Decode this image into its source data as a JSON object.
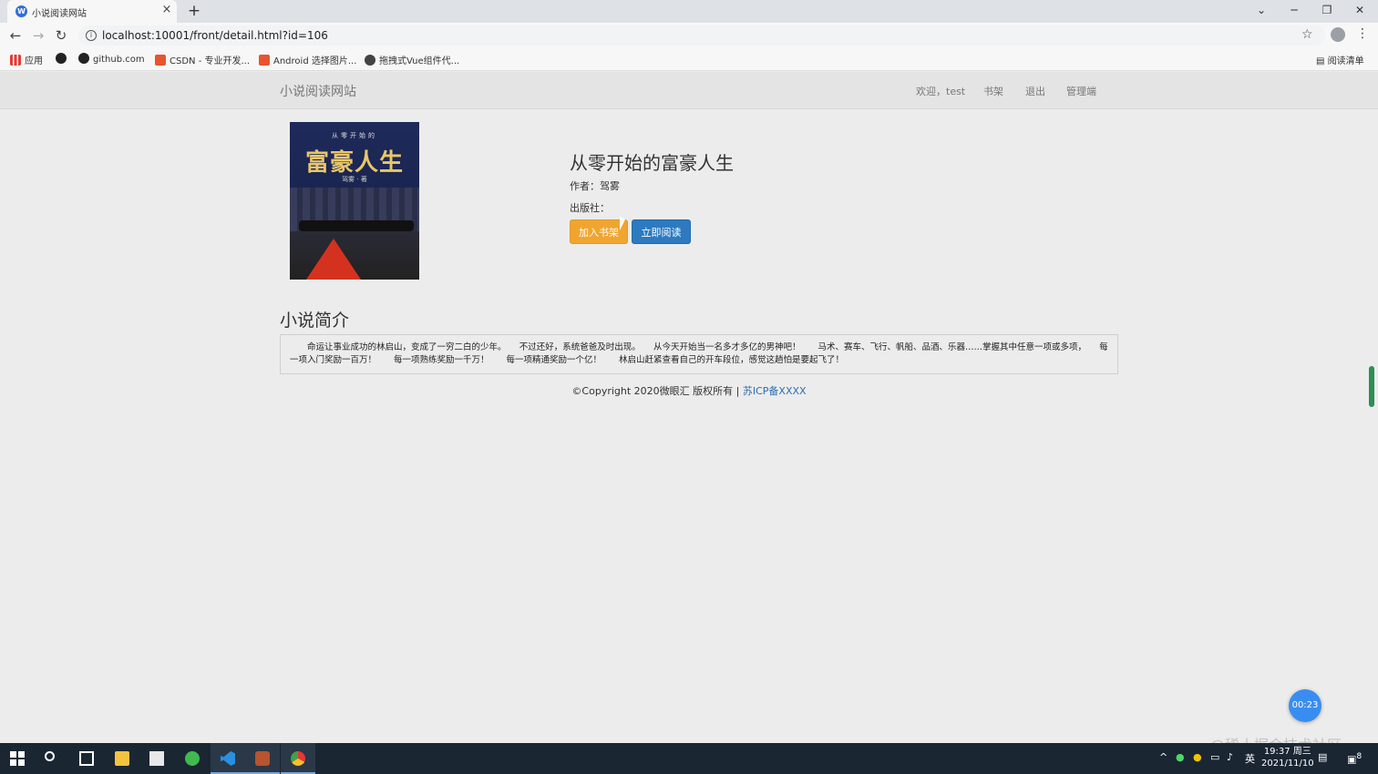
{
  "browser": {
    "tab_title": "小说阅读网站",
    "tab_close": "×",
    "new_tab": "+",
    "url": "localhost:10001/front/detail.html?id=106",
    "bookmarks": [
      {
        "label": "应用",
        "icon": "apps-icon"
      },
      {
        "label": "",
        "icon": "github-icon"
      },
      {
        "label": "github.com",
        "icon": "github-icon"
      },
      {
        "label": "CSDN - 专业开发...",
        "icon": "csdn-icon"
      },
      {
        "label": "Android 选择图片...",
        "icon": "csdn-icon"
      },
      {
        "label": "拖拽式Vue组件代...",
        "icon": "vue-icon"
      }
    ],
    "reading_list": "阅读清单"
  },
  "navbar": {
    "brand": "小说阅读网站",
    "welcome": "欢迎，test",
    "bookshelf": "书架",
    "logout": "退出",
    "admin": "管理端"
  },
  "book": {
    "cover": {
      "subtitle": "从零开始的",
      "title": "富豪人生",
      "author": "驾雾 · 著"
    },
    "title": "从零开始的富豪人生",
    "author_line": "作者：驾雾",
    "publisher_line": "出版社：",
    "add_shelf_label": "加入书架",
    "read_now_label": "立即阅读"
  },
  "intro": {
    "heading": "小说简介",
    "text": "　　命运让事业成功的林启山，变成了一穷二白的少年。　　不过还好，系统爸爸及时出现。　　从今天开始当一名多才多亿的男神吧！　　马术、赛车、飞行、帆船、品酒、乐器……掌握其中任意一项或多项，　　每一项入门奖励一百万！　　每一项熟练奖励一千万！　　每一项精通奖励一个亿！　　林启山赶紧查看自己的开车段位，感觉这趟怕是要起飞了！"
  },
  "footer": {
    "copyright": "©Copyright 2020微眼汇 版权所有 | ",
    "icp": "苏ICP备XXXX"
  },
  "overlay": {
    "timer": "00:23",
    "watermark": "@稀土掘金技术社区"
  },
  "taskbar": {
    "ime": "英",
    "time": "19:37 周三",
    "date": "2021/11/10",
    "notification_count": "8"
  },
  "colors": {
    "add_shelf": "#f0a530",
    "read_now": "#2d7ac0",
    "icp_link": "#2d6fb0"
  }
}
